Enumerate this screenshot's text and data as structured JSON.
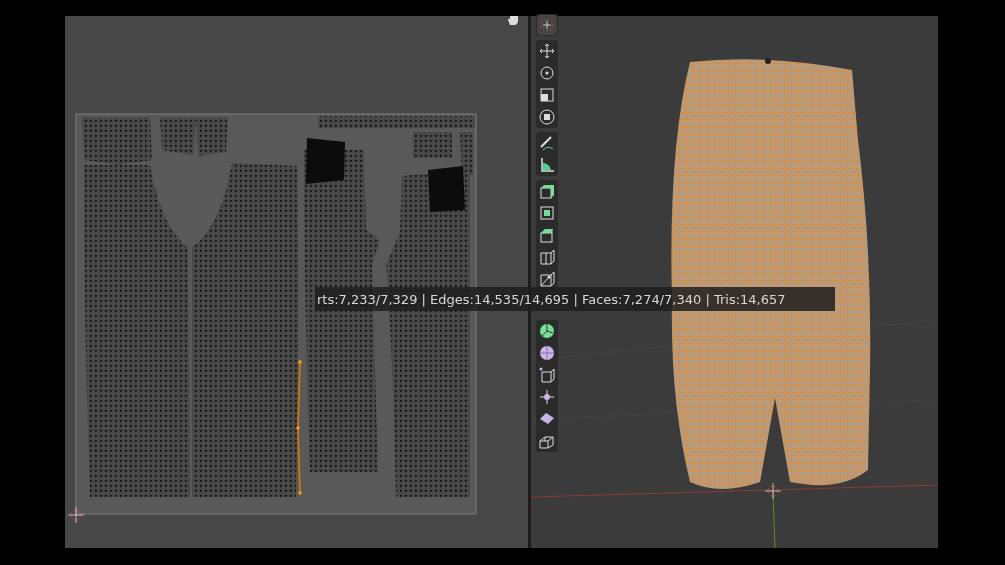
{
  "stats_overlay": {
    "text": "rts:7,233/7,329 | Edges:14,535/14,695 | Faces:7,274/7,340 | Tris:14,657"
  }
}
